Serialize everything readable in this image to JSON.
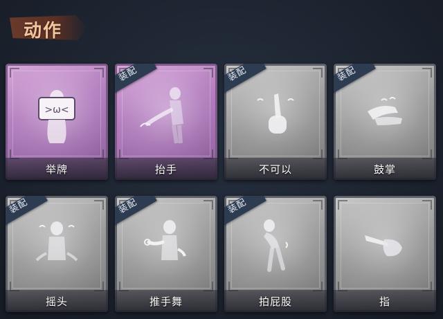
{
  "header": {
    "title": "动作"
  },
  "badge_label": "装配",
  "cards": [
    {
      "label": "举牌",
      "selected": true,
      "equipped": false,
      "icon": "sign-holding-figure-icon"
    },
    {
      "label": "抬手",
      "selected": true,
      "equipped": true,
      "icon": "raising-hand-figure-icon"
    },
    {
      "label": "不可以",
      "selected": false,
      "equipped": true,
      "icon": "wagging-finger-icon"
    },
    {
      "label": "鼓掌",
      "selected": false,
      "equipped": true,
      "icon": "clapping-hands-icon"
    },
    {
      "label": "摇头",
      "selected": false,
      "equipped": true,
      "icon": "head-shake-figure-icon"
    },
    {
      "label": "推手舞",
      "selected": false,
      "equipped": true,
      "icon": "push-dance-figure-icon"
    },
    {
      "label": "拍屁股",
      "selected": false,
      "equipped": true,
      "icon": "butt-pat-figure-icon"
    },
    {
      "label": "指",
      "selected": false,
      "equipped": false,
      "icon": "pointing-hand-icon"
    }
  ],
  "colors": {
    "background": "#1f2632",
    "selected_card": "#b47fc0",
    "normal_card": "#9c9c9c",
    "badge": "#2e3c52",
    "header_text": "#f2c79e"
  }
}
